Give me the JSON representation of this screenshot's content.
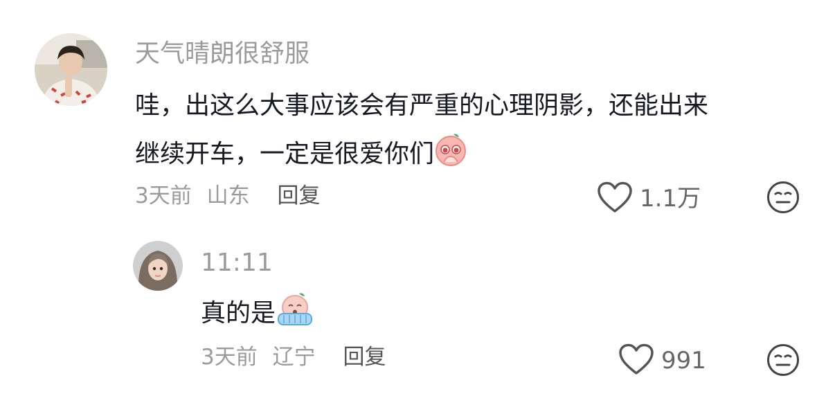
{
  "comments": [
    {
      "username": "天气晴朗很舒服",
      "text_line1": "哇，出这么大事应该会有严重的心理阴影，还能出来",
      "text_line2": "继续开车，一定是很爱你们",
      "emoji": "pleading-face-emoji",
      "time": "3天前",
      "location": "山东",
      "reply_label": "回复",
      "like_count": "1.1万"
    },
    {
      "username": "11:11",
      "text_line1": "真的是",
      "emoji": "crying-face-emoji",
      "time": "3天前",
      "location": "辽宁",
      "reply_label": "回复",
      "like_count": "991"
    }
  ],
  "icons": {
    "like": "heart-outline-icon",
    "dislike": "meh-face-icon"
  },
  "colors": {
    "username": "#9b9b9b",
    "text": "#161823",
    "meta": "#9b9b9b",
    "reply": "#555555"
  }
}
